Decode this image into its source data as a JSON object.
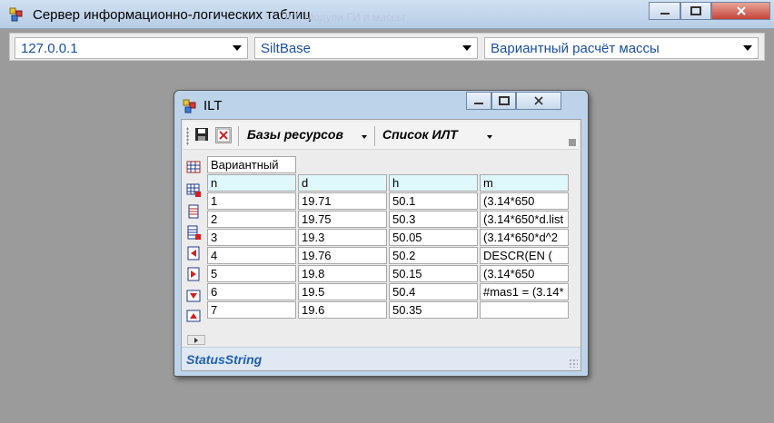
{
  "main_window": {
    "title": "Сервер информационно-логических таблиц",
    "background_text": "... ILT. Модули ГИ и массы"
  },
  "combos": {
    "server": "127.0.0.1",
    "database": "SiltBase",
    "table": "Вариантный расчёт массы"
  },
  "ilt_window": {
    "title": "ILT",
    "toolbar": {
      "save_icon": "save-icon",
      "delete_icon": "delete-icon",
      "resources_label": "Базы ресурсов",
      "ilt_list_label": "Список ИЛТ"
    },
    "side_icons": [
      "table-icon",
      "table-edit-icon",
      "rows-icon",
      "rows-edit-icon",
      "move-left-icon",
      "move-right-icon",
      "move-down-icon",
      "move-up-icon"
    ],
    "sheet": {
      "name": "Вариантный",
      "columns": [
        "n",
        "d",
        "h",
        "m"
      ],
      "rows": [
        [
          "1",
          "19.71",
          "50.1",
          "(3.14*650"
        ],
        [
          "2",
          "19.75",
          "50.3",
          "(3.14*650*d.list"
        ],
        [
          "3",
          "19.3",
          "50.05",
          "(3.14*650*d^2"
        ],
        [
          "4",
          "19.76",
          "50.2",
          "DESCR(EN ("
        ],
        [
          "5",
          "19.8",
          "50.15",
          "(3.14*650"
        ],
        [
          "6",
          "19.5",
          "50.4",
          "#mas1 = (3.14*"
        ],
        [
          "7",
          "19.6",
          "50.35",
          ""
        ]
      ]
    },
    "status": "StatusString"
  },
  "colors": {
    "status_text": "#1f5fb0",
    "header_cell": "#dff8fb",
    "combo_text": "#1a4f9c"
  }
}
